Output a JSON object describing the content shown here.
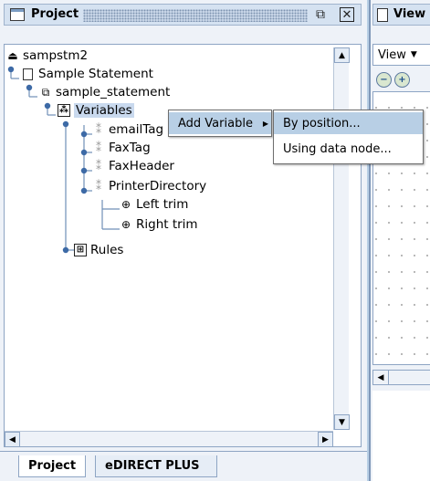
{
  "project_panel": {
    "title": "Project",
    "tree": {
      "root": "sampstm2",
      "statement": "Sample Statement",
      "statement_child": "sample_statement",
      "variables": "Variables",
      "variable_items": [
        "emailTag",
        "FaxTag",
        "FaxHeader",
        "PrinterDirectory"
      ],
      "printer_directory_children": [
        "Left trim",
        "Right trim"
      ],
      "rules": "Rules"
    },
    "tabs": [
      "Project",
      "eDIRECT PLUS"
    ]
  },
  "context_menu": {
    "add_variable": "Add Variable",
    "submenu": [
      "By position...",
      "Using data node..."
    ]
  },
  "view_panel": {
    "title": "View",
    "view_select": "View"
  },
  "icons": {
    "window": "window-icon",
    "restore": "restore-icon",
    "close": "close-icon",
    "project_root": "project-root-icon",
    "statement": "statement-document-icon",
    "statement_child": "statement-pages-icon",
    "variables": "variables-folder-icon",
    "variable": "variable-icon",
    "trim": "trim-icon",
    "rules": "rules-folder-icon",
    "zoom_out": "zoom-out-icon",
    "zoom_in": "zoom-in-icon"
  },
  "colors": {
    "selection": "#b8cfe5",
    "titlebar": "#d5e2f1",
    "panel_bg": "#eef2f8"
  }
}
